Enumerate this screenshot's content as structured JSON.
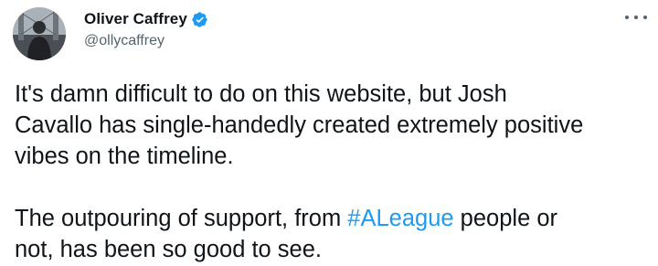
{
  "tweet": {
    "author": {
      "display_name": "Oliver Caffrey",
      "handle": "@ollycaffrey",
      "verified": true,
      "verified_color": "#1d9bf0",
      "avatar_icon": "profile-photo"
    },
    "more_icon": "more-options-icon",
    "paragraph1": {
      "line1": "It's damn difficult to do on this website, but Josh",
      "line2": "Cavallo has single-handedly created extremely positive",
      "line3": "vibes on the timeline."
    },
    "paragraph2": {
      "before_hashtag": "The outpouring of support, from ",
      "hashtag": "#ALeague",
      "after_hashtag": " people or",
      "line2": "not, has been so good to see."
    },
    "colors": {
      "text": "#0f1419",
      "secondary": "#536471",
      "link": "#1d9bf0"
    }
  }
}
